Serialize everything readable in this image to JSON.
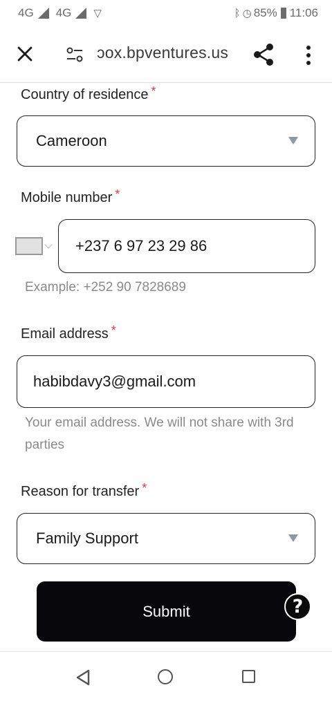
{
  "status_bar": {
    "network_1": "4G",
    "network_2": "4G",
    "battery": "85%",
    "time": "11:06",
    "icons": [
      "signal-icon",
      "vpn-icon",
      "bluetooth-icon",
      "alarm-icon",
      "battery-icon"
    ]
  },
  "browser": {
    "url": "ɔox.bpventures.us",
    "icons": [
      "close-icon",
      "site-settings-icon",
      "share-icon",
      "more-vert-icon"
    ]
  },
  "form": {
    "country": {
      "label": "Country of residence",
      "required_mark": "*",
      "value": "Cameroon"
    },
    "mobile": {
      "label": "Mobile number",
      "required_mark": "*",
      "value": "+237 6 97 23 29 86",
      "helper": "Example: +252 90 7828689"
    },
    "email": {
      "label": "Email address",
      "required_mark": "*",
      "value": "habibdavy3@gmail.com",
      "helper": "Your email address. We will not share with 3rd parties"
    },
    "reason": {
      "label": "Reason for transfer",
      "required_mark": "*",
      "value": "Family Support"
    },
    "submit_label": "Submit",
    "help_label": "?"
  },
  "nav_bar": {
    "icons": [
      "back-icon",
      "home-icon",
      "recents-icon"
    ]
  },
  "colors": {
    "required": "#e03a3a",
    "helper_text": "#8a8a8a",
    "button_bg": "#08070b",
    "select_arrow": "#8e99a4"
  }
}
